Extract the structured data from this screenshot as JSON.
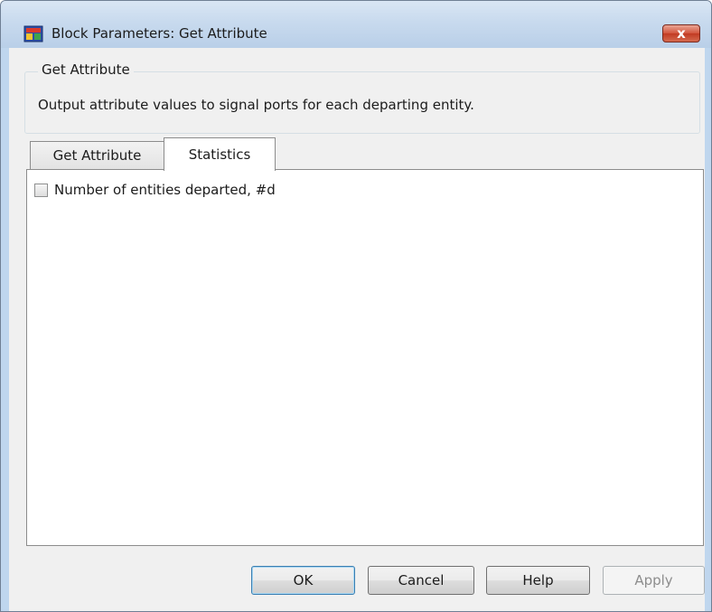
{
  "window": {
    "title": "Block Parameters: Get Attribute",
    "close_symbol": "x",
    "app_icon": "simulink-block-icon"
  },
  "group": {
    "label": "Get Attribute",
    "description": "Output attribute values to signal ports for each departing entity."
  },
  "tabs": [
    {
      "label": "Get Attribute",
      "selected": false
    },
    {
      "label": "Statistics",
      "selected": true
    }
  ],
  "statistics": {
    "departed": {
      "label": "Number of entities departed, #d",
      "checked": false
    }
  },
  "buttons": {
    "ok": "OK",
    "cancel": "Cancel",
    "help": "Help",
    "apply": "Apply"
  },
  "colors": {
    "frame": "#bfd6ee",
    "client": "#f0f0f0",
    "close_button": "#c13a22",
    "default_button_border": "#3c7fb1"
  }
}
